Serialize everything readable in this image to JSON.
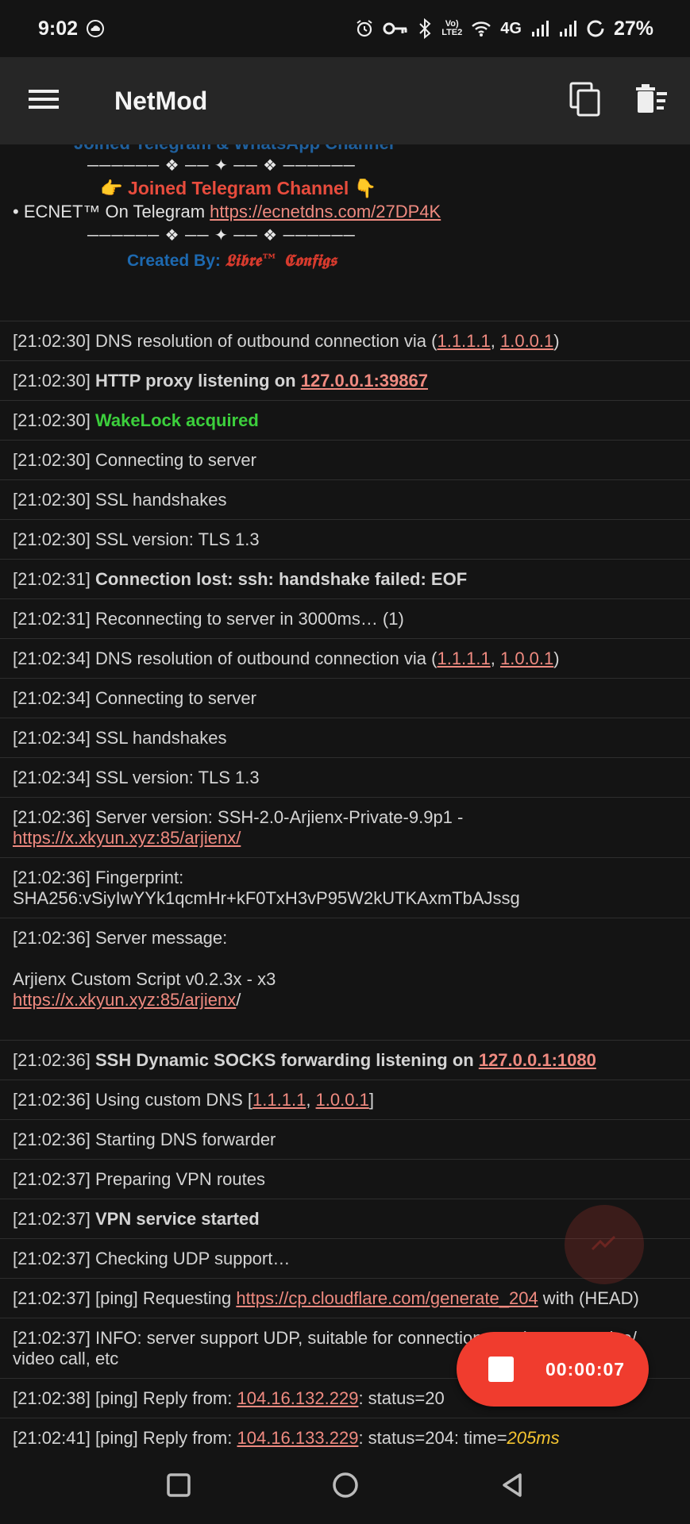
{
  "status_bar": {
    "time": "9:02",
    "network_label": "4G",
    "battery": "27%",
    "icons": [
      "cloud-icon",
      "alarm-icon",
      "vpn-key-icon",
      "bluetooth-icon",
      "volte-icon",
      "wifi-icon",
      "signal-icon",
      "signal-icon",
      "battery-ring-icon"
    ]
  },
  "app_bar": {
    "title": "NetMod",
    "menu_icon": "hamburger-menu-icon",
    "actions": [
      "copy-icon",
      "clear-log-icon"
    ]
  },
  "banner": {
    "clipped_line": "Joined Telegram & WhatsApp Channel",
    "divider": "────── ❖ ── ✦ ── ❖ ──────",
    "telegram_label": "👉 Joined Telegram Channel 👇",
    "ecnet_prefix": "• ECNET™ On Telegram ",
    "ecnet_link": "https://ecnetdns.com/27DP4K",
    "created_prefix": "Created By: ",
    "created_brand": "𝕷𝖎𝖇𝖗𝖊™ 𝕮𝖔𝖓𝖋𝖎𝖌𝖘"
  },
  "log": {
    "dns1": "1.1.1.1",
    "dns2": "1.0.0.1",
    "http_proxy": "127.0.0.1:39867",
    "socks_proxy": "127.0.0.1:1080",
    "server_url": "https://x.xkyun.xyz:85/arjienx/",
    "server_url_short": "https://x.xkyun.xyz:85/arjienx",
    "ping_url": "https://cp.cloudflare.com/generate_204",
    "ip1": "104.16.132.229",
    "ip2": "104.16.133.229",
    "ping_time": "205ms",
    "lines": {
      "l1a": "[21:02:30] DNS resolution of outbound connection via (",
      "l1sep": ", ",
      "l1end": ")",
      "l2a": "[21:02:30] ",
      "l2b": "HTTP proxy listening on ",
      "l3a": "[21:02:30] ",
      "l3b": "WakeLock acquired",
      "l4": "[21:02:30] Connecting to server",
      "l5": "[21:02:30] SSL handshakes",
      "l6": "[21:02:30] SSL version: TLS 1.3",
      "l7a": "[21:02:31] ",
      "l7b": "Connection lost: ssh: handshake failed: EOF",
      "l8": "[21:02:31] Reconnecting to server in 3000ms… (1)",
      "l9a": "[21:02:34] DNS resolution of outbound connection via (",
      "l10": "[21:02:34] Connecting to server",
      "l11": "[21:02:34] SSL handshakes",
      "l12": "[21:02:34] SSL version: TLS 1.3",
      "l13a": "[21:02:36] Server version: SSH-2.0-Arjienx-Private-9.9p1 - ",
      "l14a": "[21:02:36] Fingerprint:",
      "l14b": "SHA256:vSiyIwYYk1qcmHr+kF0TxH3vP95W2kUTKAxmTbAJssg",
      "l15a": "[21:02:36] Server message:",
      "l15b": "Arjienx Custom Script v0.2.3x - x3",
      "l15slash": "/",
      "l16a": "[21:02:36] ",
      "l16b": "SSH Dynamic SOCKS forwarding listening on ",
      "l17a": "[21:02:36] Using custom DNS [",
      "l17end": "]",
      "l18": "[21:02:36] Starting DNS forwarder",
      "l19": "[21:02:37] Preparing VPN routes",
      "l20a": "[21:02:37] ",
      "l20b": "VPN service started",
      "l21": "[21:02:37] Checking UDP support…",
      "l22a": "[21:02:37] [ping] Requesting ",
      "l22b": " with (HEAD)",
      "l23": "[21:02:37] INFO: server support UDP, suitable for connections such game, voice/ video call, etc",
      "l24a": "[21:02:38] [ping] Reply from: ",
      "l24b": ": status=20",
      "l25a": "[21:02:41] [ping] Reply from: ",
      "l25b": ": status=204: time="
    }
  },
  "fab": {
    "chart_icon": "trending-up-icon",
    "stop_icon": "stop-icon",
    "timer": "00:00:07"
  },
  "nav_bar": [
    "recents-square-icon",
    "home-circle-icon",
    "back-triangle-icon"
  ]
}
